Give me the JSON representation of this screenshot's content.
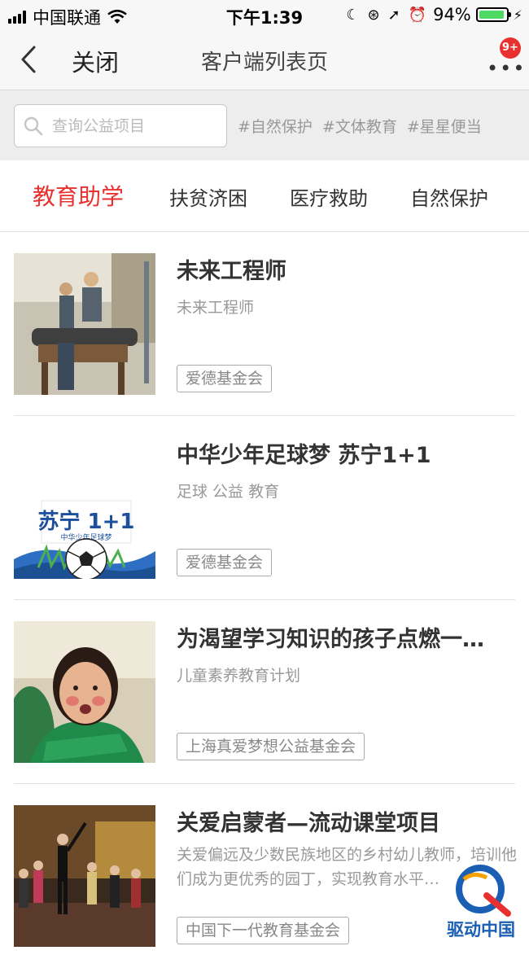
{
  "status_bar": {
    "carrier": "中国联通",
    "time": "下午1:39",
    "battery_percent": "94%",
    "battery_level": 0.94
  },
  "nav": {
    "close_label": "关闭",
    "title": "客户端列表页",
    "badge": "9+"
  },
  "search": {
    "placeholder": "查询公益项目",
    "hashtags": [
      "#自然保护",
      "#文体教育",
      "#星星便当"
    ]
  },
  "tabs": [
    {
      "label": "教育助学",
      "active": true
    },
    {
      "label": "扶贫济困",
      "active": false
    },
    {
      "label": "医疗救助",
      "active": false
    },
    {
      "label": "自然保护",
      "active": false
    }
  ],
  "items": [
    {
      "title": "未来工程师",
      "subtitle": "未来工程师",
      "tag": "爱德基金会"
    },
    {
      "title": "中华少年足球梦 苏宁1+1",
      "subtitle": "足球 公益 教育",
      "tag": "爱德基金会",
      "logo_text": "苏宁 1+1",
      "logo_sub": "中华少年足球梦"
    },
    {
      "title": "为渴望学习知识的孩子点燃一…",
      "subtitle": "儿童素养教育计划",
      "tag": "上海真爱梦想公益基金会"
    },
    {
      "title": "关爱启蒙者—流动课堂项目",
      "subtitle": "关爱偏远及少数民族地区的乡村幼儿教师，培训他们成为更优秀的园丁，实现教育水平…",
      "tag": "中国下一代教育基金会"
    }
  ],
  "watermark": {
    "text": "驱动中国"
  },
  "colors": {
    "accent": "#e8312f",
    "battery": "#4cd964",
    "watermark": "#1a5fb4"
  }
}
